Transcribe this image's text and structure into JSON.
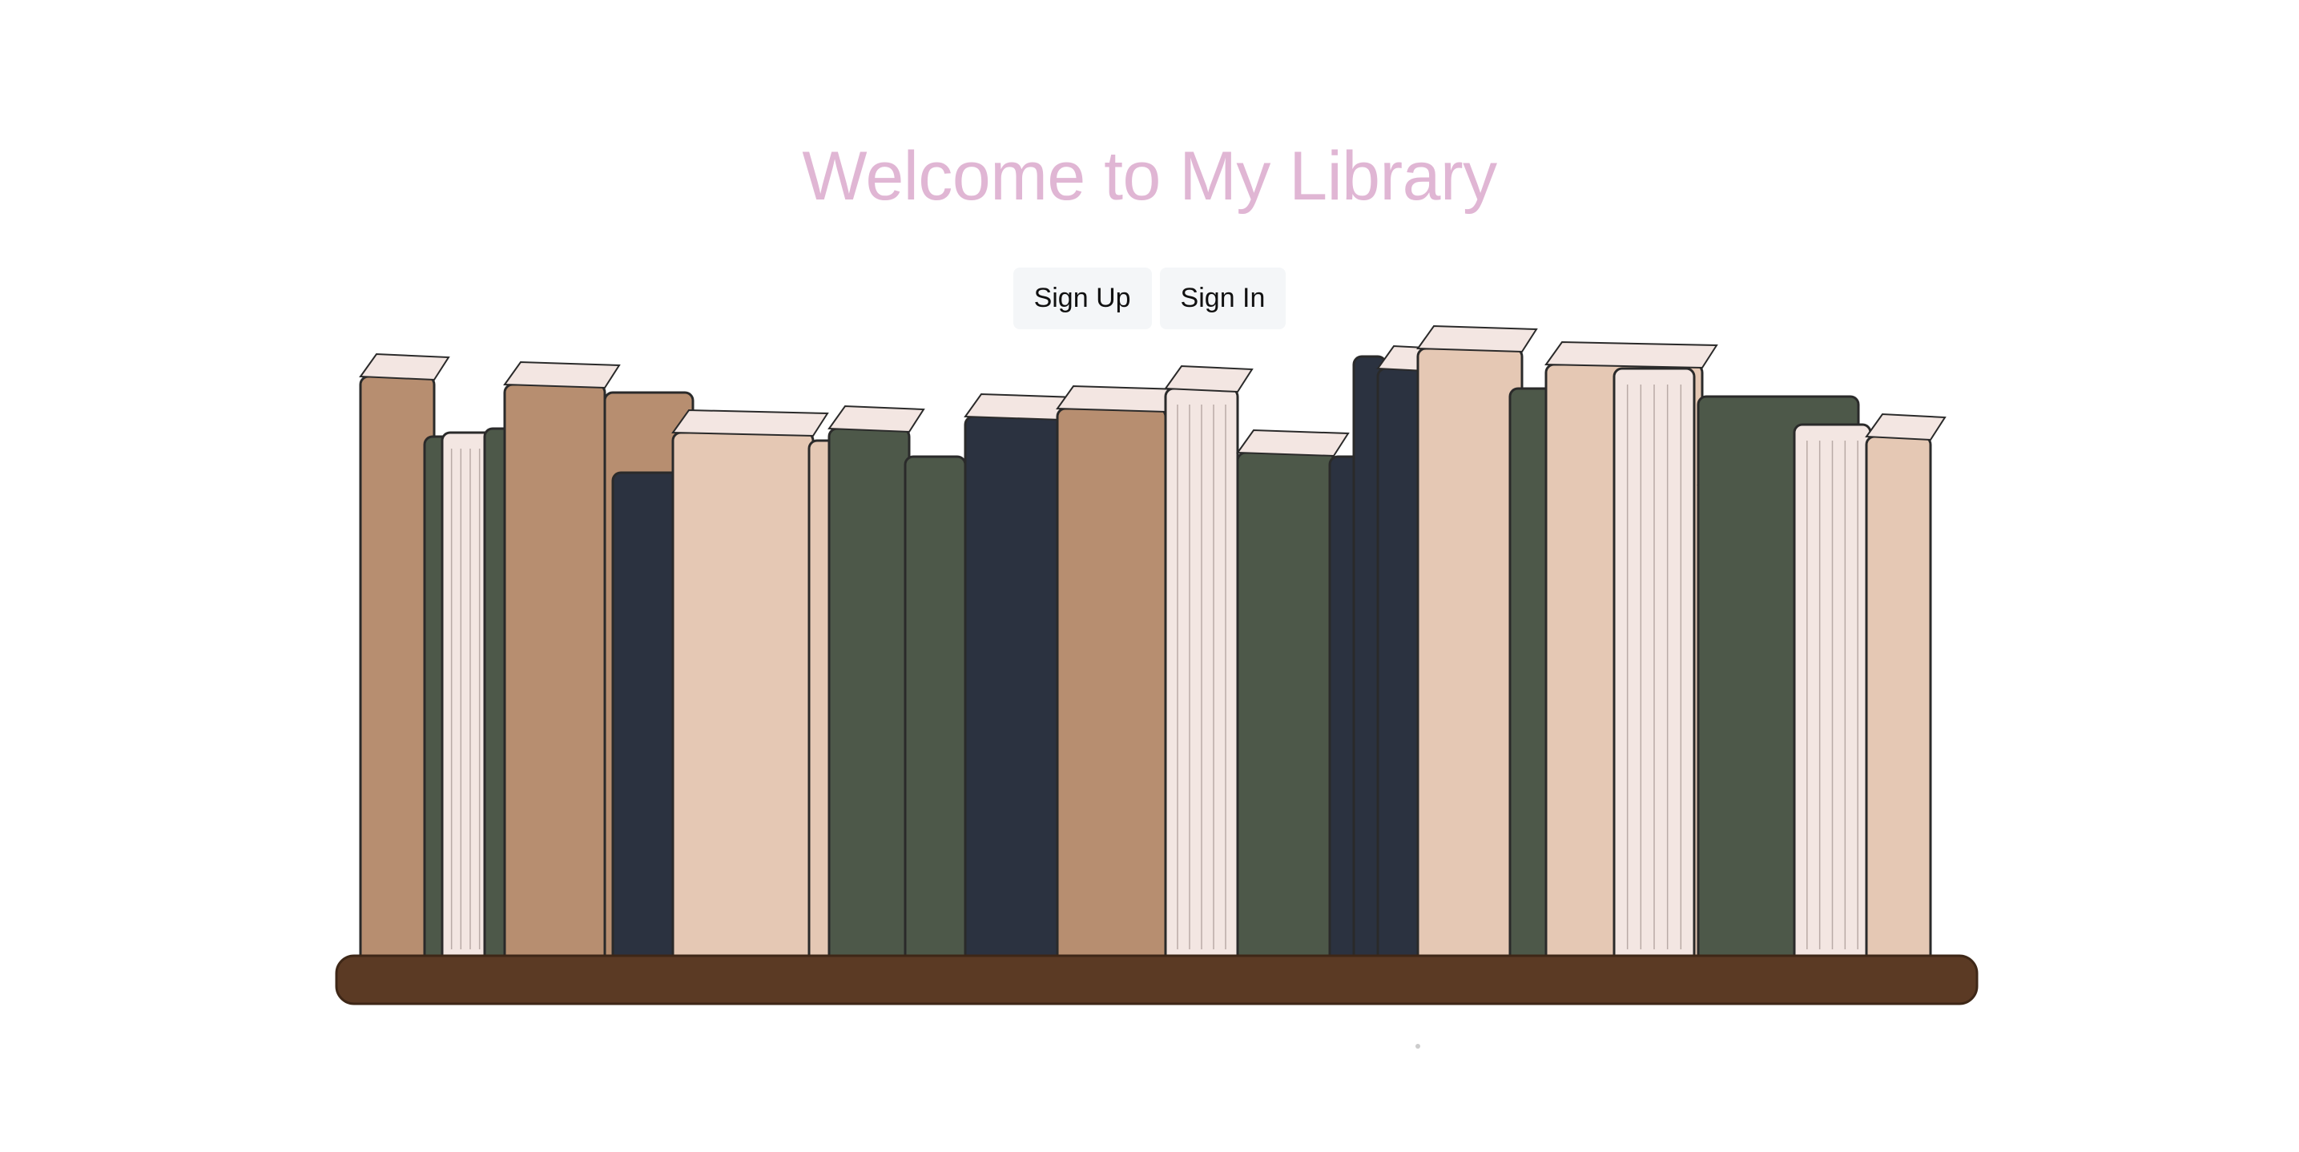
{
  "header": {
    "title": "Welcome to My Library"
  },
  "actions": {
    "sign_up_label": "Sign Up",
    "sign_in_label": "Sign In"
  },
  "colors": {
    "title": "#e0b6d4",
    "button_bg": "#f4f6f8",
    "shelf": "#5b3a24",
    "tan": "#b78e70",
    "beige": "#e5c8b4",
    "green": "#4d5849",
    "navy": "#2b3240",
    "paper": "#f3e6e2"
  },
  "illustration": {
    "name": "bookshelf-illustration"
  }
}
